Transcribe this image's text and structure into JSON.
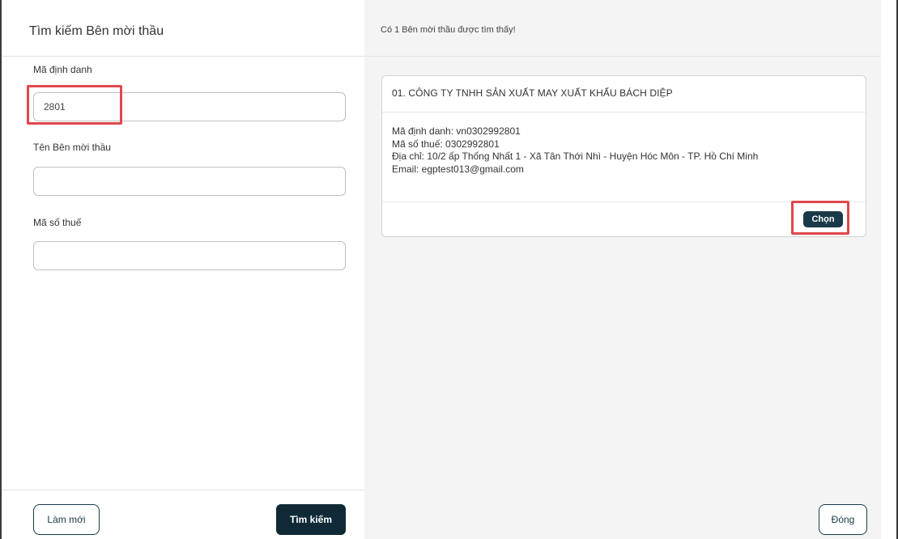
{
  "search_panel": {
    "title": "Tìm kiếm Bên mời thầu",
    "fields": {
      "identifier": {
        "label": "Mã định danh",
        "value": "2801"
      },
      "name": {
        "label": "Tên Bên mời thầu",
        "value": ""
      },
      "tax_code": {
        "label": "Mã số thuế",
        "value": ""
      }
    },
    "reset_label": "Làm mới",
    "search_label": "Tìm kiếm"
  },
  "results_panel": {
    "summary": "Có 1 Bên mời thầu được tìm thấy!",
    "results": [
      {
        "title": "01. CÔNG TY TNHH SẢN XUẤT MAY XUẤT KHẨU BÁCH DIỆP",
        "identifier_line": "Mã định danh: vn0302992801",
        "tax_line": "Mã số thuế: 0302992801",
        "address_line": "Địa chỉ: 10/2 ấp Thống Nhất 1 - Xã Tân Thới Nhì - Huyện Hóc Môn - TP. Hồ Chí Minh",
        "email_line": "Email: egptest013@gmail.com",
        "choose_label": "Chọn"
      }
    ],
    "close_label": "Đóng"
  },
  "colors": {
    "highlight": "#e0474c",
    "primary_dark": "#0f2a36",
    "panel_gray": "#f4f4f4"
  }
}
